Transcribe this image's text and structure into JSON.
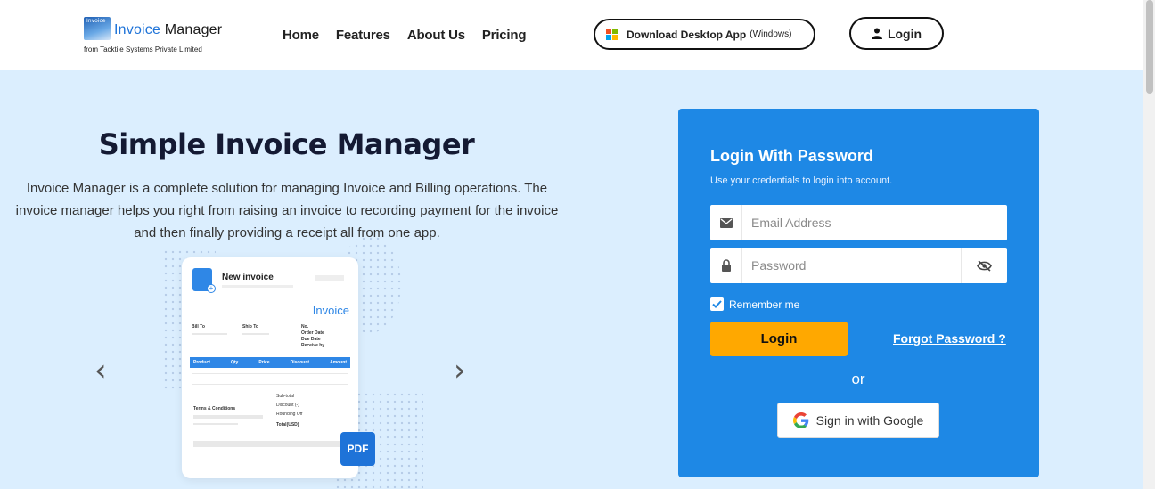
{
  "header": {
    "logo": {
      "mark_text": "Invoice",
      "title_part1": "Invoice",
      "title_part2": "Manager",
      "subtitle": "from Tacktile Systems Private Limited"
    },
    "nav": [
      "Home",
      "Features",
      "About Us",
      "Pricing"
    ],
    "download_button": {
      "label": "Download Desktop App",
      "sub_label": "(Windows)",
      "icon": "windows-icon"
    },
    "login_button": {
      "label": "Login",
      "icon": "user-icon"
    }
  },
  "hero": {
    "title": "Simple Invoice Manager",
    "description": "Invoice Manager is a complete solution for managing Invoice and Billing operations. The invoice manager helps you right from raising an invoice to recording payment for the invoice and then finally providing a receipt all from one app."
  },
  "invoice_card": {
    "heading": "New invoice",
    "label": "Invoice",
    "bill_to": "Bill To",
    "ship_to": "Ship To",
    "meta_labels": [
      "No.",
      "Order Date",
      "Due Date",
      "Receive by"
    ],
    "columns": [
      "Product",
      "Qty",
      "Price",
      "Discount",
      "Amount"
    ],
    "terms": "Terms & Conditions",
    "totals": [
      "Sub-total",
      "Discount (-)",
      "Rounding Off",
      "Total(USD)"
    ],
    "pdf_badge": "PDF"
  },
  "carousel": {
    "prev_icon": "chevron-left-icon",
    "next_icon": "chevron-right-icon"
  },
  "login_panel": {
    "title": "Login With Password",
    "subtitle": "Use your credentials to login into account.",
    "email": {
      "placeholder": "Email Address",
      "value": "",
      "icon": "mail-icon"
    },
    "password": {
      "placeholder": "Password",
      "value": "",
      "icon": "lock-icon",
      "toggle_icon": "eye-off-icon"
    },
    "remember_label": "Remember me",
    "remember_checked": true,
    "login_label": "Login",
    "forgot_label": "Forgot Password ?",
    "or_label": "or",
    "google_label": "Sign in with Google"
  },
  "colors": {
    "accent_blue": "#1e88e5",
    "login_button": "#ffa800",
    "hero_bg": "#dbeefe"
  }
}
